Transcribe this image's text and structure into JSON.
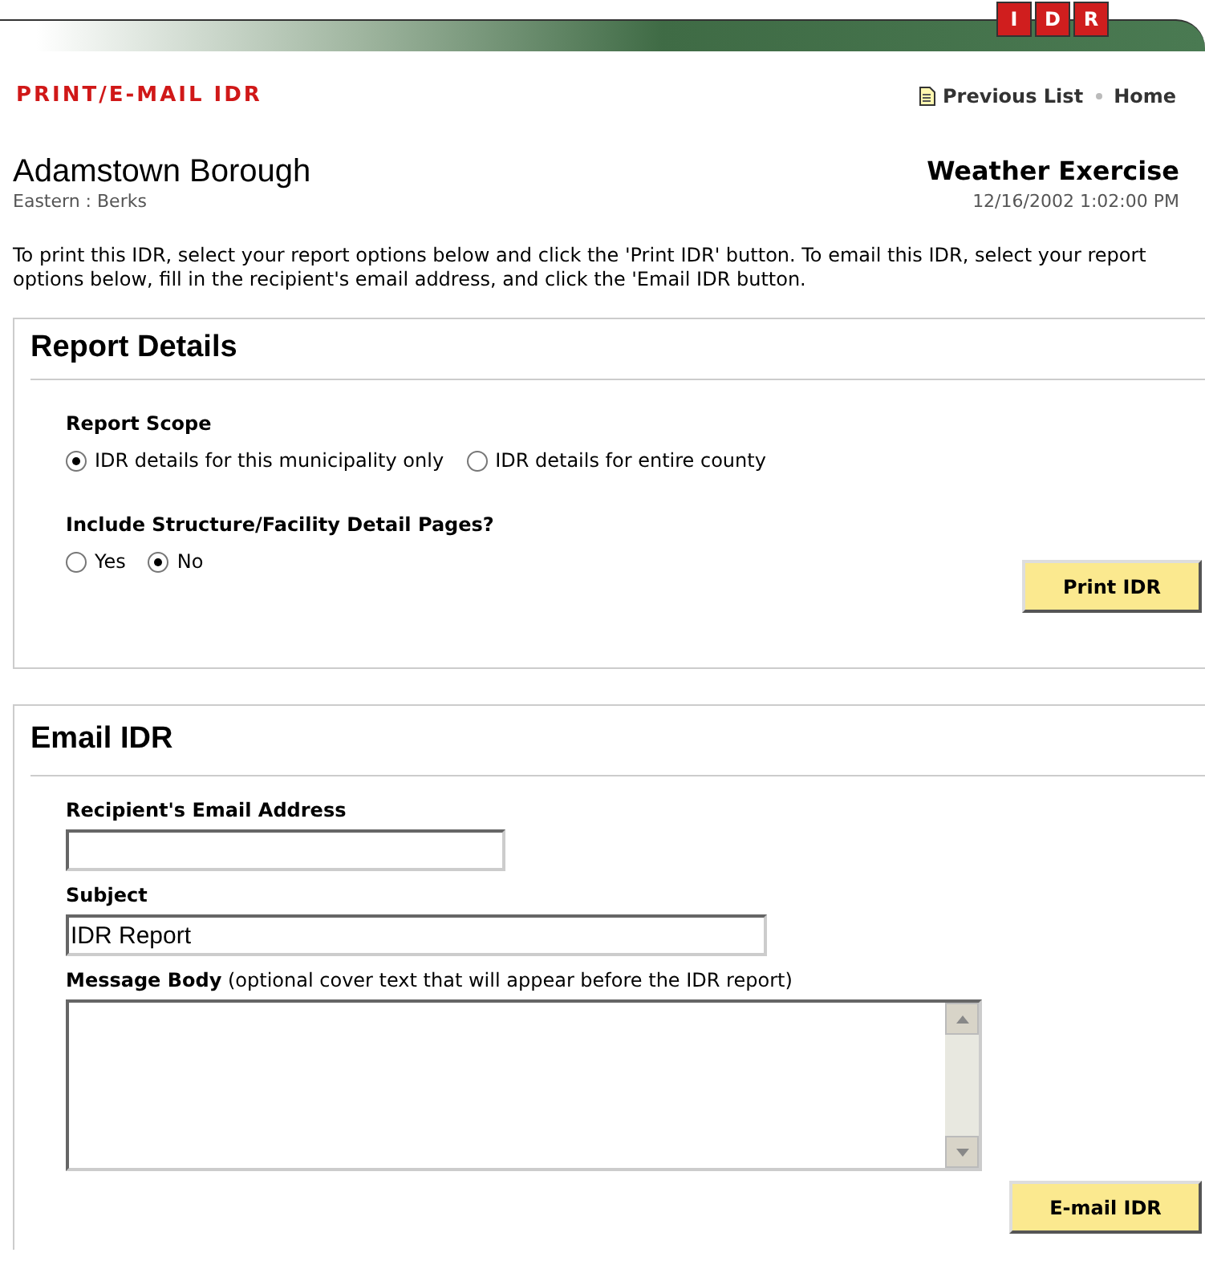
{
  "logo": {
    "letters": [
      "I",
      "D",
      "R"
    ]
  },
  "page_title": "PRINT/E-MAIL IDR",
  "nav": [
    {
      "label": "Previous List",
      "kind": "doc"
    },
    {
      "label": "Home",
      "kind": "plain"
    }
  ],
  "header": {
    "name": "Adamstown Borough",
    "region": "Eastern : Berks",
    "exercise": "Weather Exercise",
    "timestamp": "12/16/2002 1:02:00 PM"
  },
  "intro": "To print this IDR, select your report options below and click the 'Print IDR' button. To email this IDR, select your report options below, fill in the recipient's email address, and click the 'Email IDR button.",
  "report_details": {
    "title": "Report Details",
    "groups": [
      {
        "label": "Report Scope",
        "options": [
          {
            "label": "IDR details for this municipality only",
            "selected": true
          },
          {
            "label": "IDR details for entire county",
            "selected": false
          }
        ]
      },
      {
        "label": "Include Structure/Facility Detail Pages?",
        "options": [
          {
            "label": "Yes",
            "selected": false
          },
          {
            "label": "No",
            "selected": true
          }
        ]
      }
    ],
    "button": "Print IDR"
  },
  "email": {
    "title": "Email IDR",
    "recipient_label": "Recipient's Email Address",
    "subject_label": "Subject",
    "subject_value": "IDR Report",
    "body_label": "Message Body",
    "body_hint": "(optional cover text that will appear before the IDR report)",
    "button": "E-mail IDR"
  }
}
